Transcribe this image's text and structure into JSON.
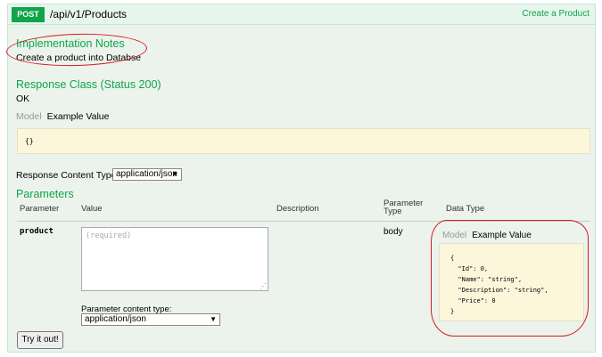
{
  "header": {
    "method": "POST",
    "path": "/api/v1/Products",
    "summary_link": "Create a Product"
  },
  "implementation": {
    "title": "Implementation Notes",
    "text": "Create a product into Databse"
  },
  "response_class": {
    "title": "Response Class (Status 200)",
    "text": "OK",
    "tab_model": "Model",
    "tab_example": "Example Value",
    "example_json": "{}"
  },
  "content_type": {
    "label": "Response Content Type",
    "value": "application/json"
  },
  "parameters": {
    "title": "Parameters",
    "columns": {
      "parameter": "Parameter",
      "value": "Value",
      "description": "Description",
      "parameter_type": "Parameter\nType",
      "data_type": "Data Type"
    },
    "row": {
      "name": "product",
      "placeholder": "(required)",
      "param_type": "body",
      "content_type_label": "Parameter content type:",
      "content_type_value": "application/json",
      "tab_model": "Model",
      "tab_example": "Example Value",
      "example_json": "{\n  \"Id\": 0,\n  \"Name\": \"string\",\n  \"Description\": \"string\",\n  \"Price\": 0\n}"
    }
  },
  "try_button": "Try it out!",
  "colors": {
    "accent": "#10a54a",
    "panel_bg": "#ebf3ec",
    "example_bg": "#fcf6db",
    "annotation": "#d71920"
  }
}
